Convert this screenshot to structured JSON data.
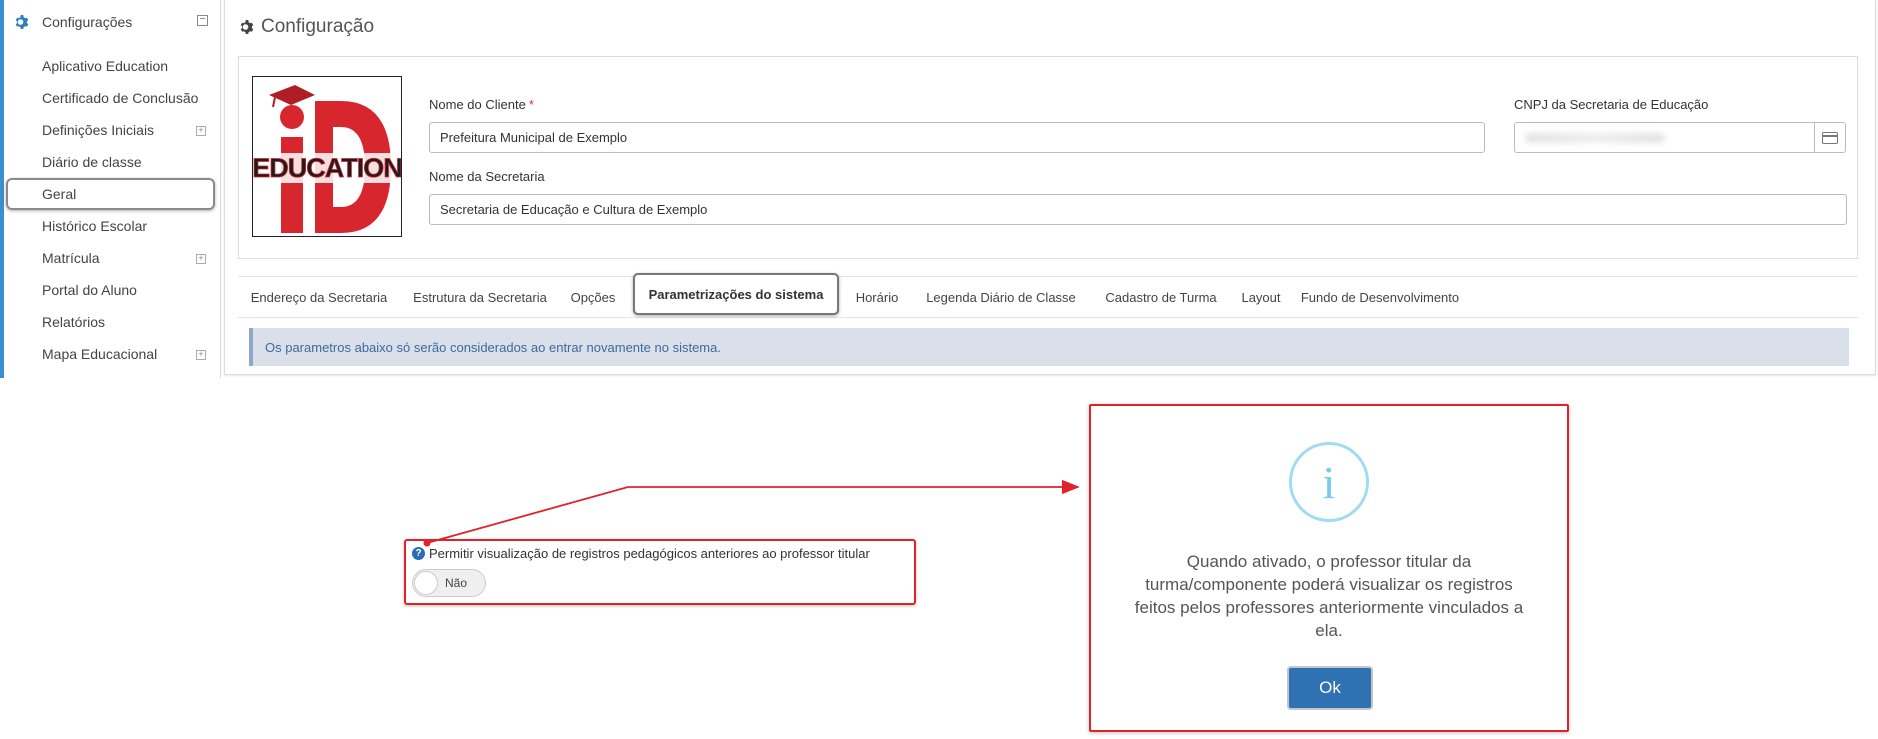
{
  "sidebar": {
    "section_title": "Configurações",
    "items": [
      {
        "label": "Aplicativo Education",
        "expandable": false
      },
      {
        "label": "Certificado de Conclusão",
        "expandable": false
      },
      {
        "label": "Definições Iniciais",
        "expandable": true
      },
      {
        "label": "Diário de classe",
        "expandable": false
      },
      {
        "label": "Geral",
        "expandable": false,
        "active": true
      },
      {
        "label": "Histórico Escolar",
        "expandable": false
      },
      {
        "label": "Matrícula",
        "expandable": true
      },
      {
        "label": "Portal do Aluno",
        "expandable": false
      },
      {
        "label": "Relatórios",
        "expandable": false
      },
      {
        "label": "Mapa Educacional",
        "expandable": true
      }
    ]
  },
  "main": {
    "title": "Configuração",
    "logo_text": "EDUCATION",
    "logo_mark": "iD",
    "client_name_label": "Nome do Cliente",
    "client_name_required": "*",
    "client_name_value": "Prefeitura Municipal de Exemplo",
    "cnpj_label": "CNPJ da Secretaria de Educação",
    "secretaria_label": "Nome da Secretaria",
    "secretaria_value": "Secretaria de Educação e Cultura de Exemplo",
    "tabs": [
      {
        "label": "Endereço da Secretaria"
      },
      {
        "label": "Estrutura da Secretaria"
      },
      {
        "label": "Opções"
      },
      {
        "label": "Parametrizações do sistema",
        "active": true
      },
      {
        "label": "Horário"
      },
      {
        "label": "Legenda Diário de Classe"
      },
      {
        "label": "Cadastro de Turma"
      },
      {
        "label": "Layout"
      },
      {
        "label": "Fundo de Desenvolvimento"
      }
    ],
    "alert": "Os parametros abaixo só serão considerados ao entrar novamente no sistema."
  },
  "annotation": {
    "help_icon": "?",
    "setting_label": "Permitir visualização de registros pedagógicos anteriores ao professor titular",
    "toggle_value": "Não"
  },
  "dialog": {
    "icon": "i",
    "message": "Quando ativado, o professor titular da turma/componente poderá visualizar os registros feitos pelos professores anteriormente vinculados a ela.",
    "ok_label": "Ok"
  },
  "colors": {
    "accent": "#3a8fd0",
    "highlight_red": "#e0222a",
    "ok_button": "#2f72b4",
    "alert_bg": "#d9e0ea",
    "info_icon": "#79cbea"
  }
}
